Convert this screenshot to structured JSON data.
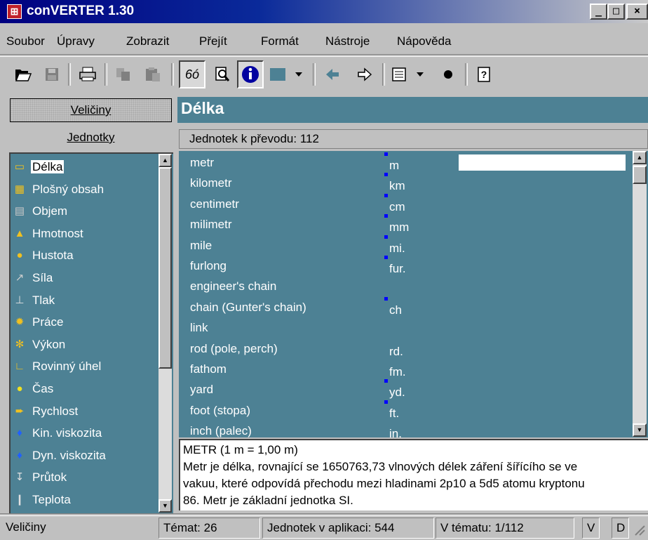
{
  "window": {
    "title": "conVERTER 1.30",
    "controls": [
      "_",
      "□",
      "×"
    ]
  },
  "menu": [
    "Soubor",
    "Úpravy",
    "Zobrazit",
    "Přejít",
    "Formát",
    "Nástroje",
    "Nápověda"
  ],
  "toolbar": {
    "icons": [
      "open-icon",
      "save-icon",
      "print-icon",
      "copy-icon",
      "paste-icon",
      "glasses-icon",
      "find-icon",
      "info-icon",
      "color-icon",
      "back-icon",
      "forward-icon",
      "list-icon",
      "bullet-icon",
      "help-icon"
    ]
  },
  "left": {
    "veliciny_label": "Veličiny",
    "jednotky_label": "Jednotky",
    "categories": [
      {
        "label": "Délka",
        "icon": "ruler-icon",
        "glyph": "▭",
        "color": "#f0c020"
      },
      {
        "label": "Plošný obsah",
        "icon": "area-icon",
        "glyph": "▦",
        "color": "#f0c020"
      },
      {
        "label": "Objem",
        "icon": "volume-icon",
        "glyph": "▤",
        "color": "#c8c8c8"
      },
      {
        "label": "Hmotnost",
        "icon": "weight-icon",
        "glyph": "▲",
        "color": "#f0c020"
      },
      {
        "label": "Hustota",
        "icon": "density-icon",
        "glyph": "●",
        "color": "#f0c020"
      },
      {
        "label": "Síla",
        "icon": "force-icon",
        "glyph": "↗",
        "color": "#d0d0d0"
      },
      {
        "label": "Tlak",
        "icon": "pressure-icon",
        "glyph": "⊥",
        "color": "#e0e0e0"
      },
      {
        "label": "Práce",
        "icon": "work-icon",
        "glyph": "✹",
        "color": "#f0c020"
      },
      {
        "label": "Výkon",
        "icon": "power-icon",
        "glyph": "✻",
        "color": "#f0c020"
      },
      {
        "label": "Rovinný úhel",
        "icon": "angle-icon",
        "glyph": "∟",
        "color": "#f0c020"
      },
      {
        "label": "Čas",
        "icon": "clock-icon",
        "glyph": "●",
        "color": "#f0e020"
      },
      {
        "label": "Rychlost",
        "icon": "speed-icon",
        "glyph": "➨",
        "color": "#f0c020"
      },
      {
        "label": "Kin. viskozita",
        "icon": "drop-icon",
        "glyph": "♦",
        "color": "#2060ff"
      },
      {
        "label": "Dyn. viskozita",
        "icon": "drops-icon",
        "glyph": "♦",
        "color": "#2060ff"
      },
      {
        "label": "Průtok",
        "icon": "flow-icon",
        "glyph": "↧",
        "color": "#e0e0e0"
      },
      {
        "label": "Teplota",
        "icon": "thermometer-icon",
        "glyph": "❙",
        "color": "#e0e0e0"
      }
    ]
  },
  "topic": {
    "title": "Délka",
    "count_text": "Jednotek k převodu: 112"
  },
  "units": [
    {
      "name": "metr",
      "abbr": "m",
      "mark": true
    },
    {
      "name": "kilometr",
      "abbr": "km",
      "mark": true
    },
    {
      "name": "centimetr",
      "abbr": "cm",
      "mark": true
    },
    {
      "name": "milimetr",
      "abbr": "mm",
      "mark": true
    },
    {
      "name": "mile",
      "abbr": "mi.",
      "mark": true
    },
    {
      "name": "furlong",
      "abbr": "fur.",
      "mark": true
    },
    {
      "name": "engineer's chain",
      "abbr": "",
      "mark": false
    },
    {
      "name": "chain (Gunter's chain)",
      "abbr": "ch",
      "mark": true
    },
    {
      "name": "link",
      "abbr": "",
      "mark": false
    },
    {
      "name": "rod (pole, perch)",
      "abbr": "rd.",
      "mark": false
    },
    {
      "name": "fathom",
      "abbr": "fm.",
      "mark": false
    },
    {
      "name": "yard",
      "abbr": "yd.",
      "mark": true
    },
    {
      "name": "foot (stopa)",
      "abbr": "ft.",
      "mark": true
    },
    {
      "name": "inch (palec)",
      "abbr": "in.",
      "mark": false
    }
  ],
  "description": {
    "line1": "METR (1 m = 1,00 m)",
    "line2": "Metr je délka, rovnající se 1650763,73 vlnových délek záření šířícího se ve",
    "line3": "vakuu, které odpovídá přechodu mezi hladinami 2p10 a 5d5 atomu kryptonu",
    "line4": "86. Metr je základní jednotka SI."
  },
  "status": {
    "left": "Veličiny",
    "temat": "Témat: 26",
    "jednotek": "Jednotek v aplikaci: 544",
    "v_tematu": "V tématu: 1/112",
    "v": "V",
    "d": "D"
  }
}
